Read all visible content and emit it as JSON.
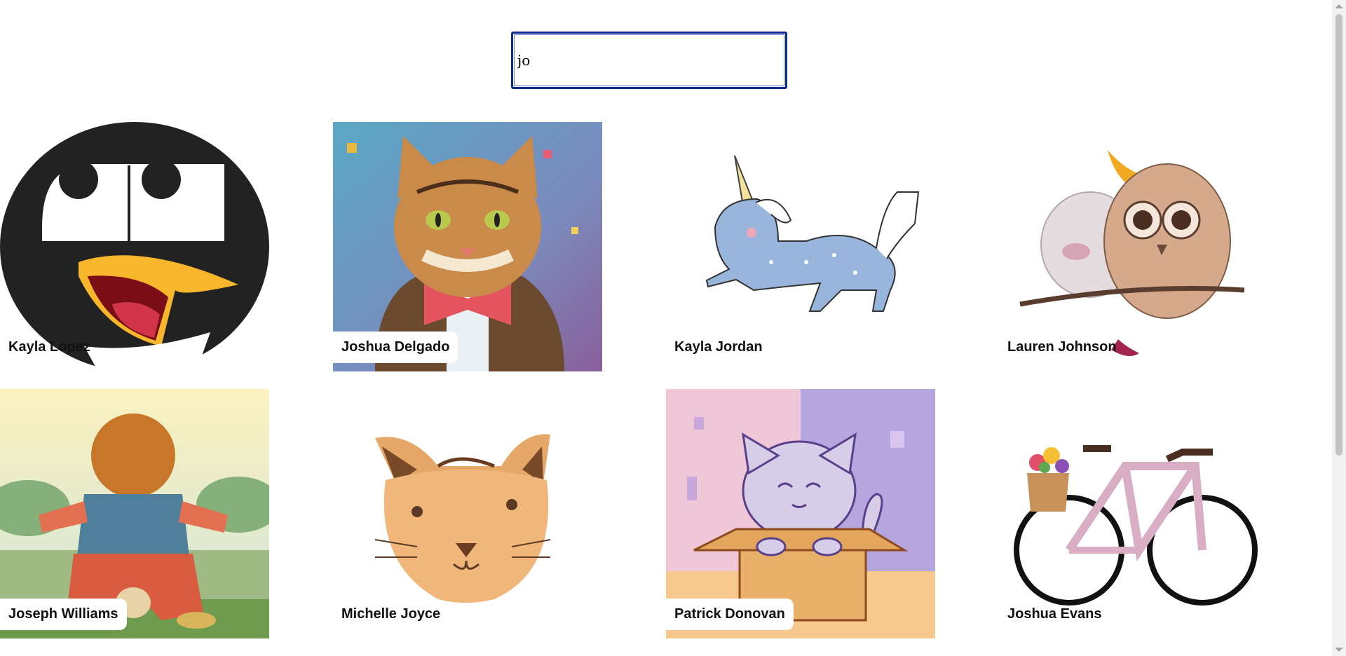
{
  "search": {
    "value": "jo",
    "placeholder": ""
  },
  "cards": [
    {
      "name": "Kayla Lopez",
      "image": "penguin-icon"
    },
    {
      "name": "Joshua Delgado",
      "image": "cat-in-bowtie-painting"
    },
    {
      "name": "Kayla Jordan",
      "image": "unicorn-icon"
    },
    {
      "name": "Lauren Johnson",
      "image": "owls-icon"
    },
    {
      "name": "Joseph Williams",
      "image": "boy-and-dog-illustration"
    },
    {
      "name": "Michelle Joyce",
      "image": "cat-face-icon"
    },
    {
      "name": "Patrick Donovan",
      "image": "cat-in-box-illustration"
    },
    {
      "name": "Joshua Evans",
      "image": "bicycle-icon"
    }
  ],
  "colors": {
    "search_border": "#0a2a8c",
    "tag_background": "#ffffff",
    "penguin_black": "#222222",
    "penguin_beak": "#f7b62b"
  }
}
